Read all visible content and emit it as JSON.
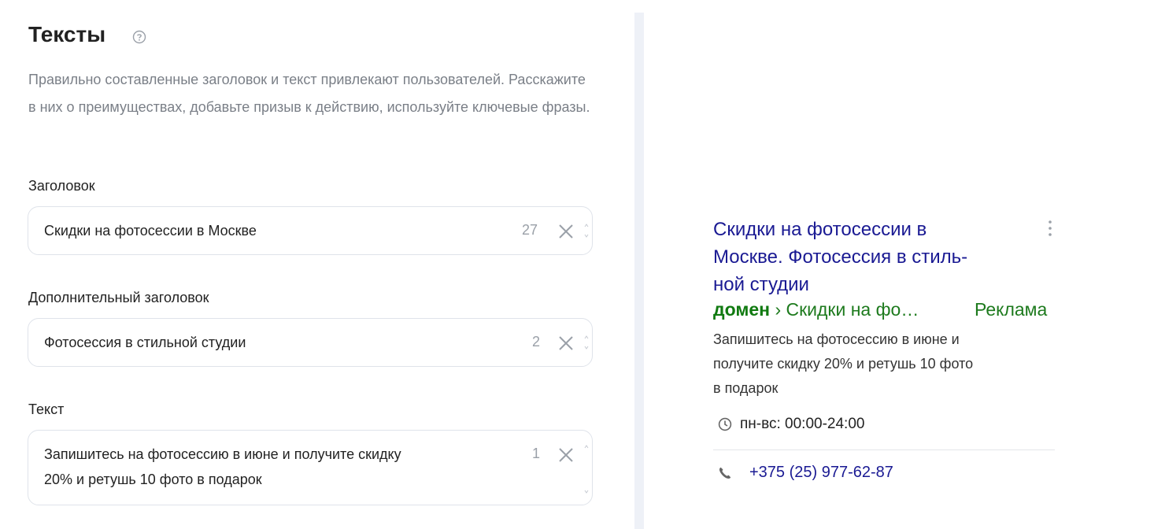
{
  "section": {
    "title": "Тексты",
    "description": "Правильно составленные заголовок и текст привлекают пользователей. Расскажите в них о преимуществах, добавьте призыв к действию, используйте ключевые фразы."
  },
  "fields": {
    "headline": {
      "label": "Заголовок",
      "value": "Скидки на фотосессии в Москве",
      "counter": "27"
    },
    "extra_headline": {
      "label": "Дополнительный заголовок",
      "value": "Фотосессия в стильной студии",
      "counter": "2"
    },
    "text": {
      "label": "Текст",
      "value_line1": "Запишитесь на фотосессию в июне и получите скидку",
      "value_line2": "20% и ретушь 10 фото в подарок",
      "counter": "1"
    }
  },
  "preview": {
    "title_line1": "Скидки на фотосессии в",
    "title_line2": "Москве. Фотосессия в стиль-",
    "title_line3": "ной студии",
    "domain": "домен",
    "path": "› Скидки на фо…",
    "ad_label": "Реклама",
    "text_line1": "Запишитесь на фотосессию в июне и",
    "text_line2": "получите скидку 20% и ретушь 10 фото",
    "text_line3": "в подарок",
    "hours": "пн-вс: 00:00-24:00",
    "phone": "+375 (25) 977-62-87"
  },
  "colors": {
    "link": "#1a1a93",
    "url_green": "#1d7a1d",
    "muted": "#7a7f87",
    "field_border": "#dfe3ea",
    "divider": "#eef1f7"
  },
  "icons": [
    "help-icon",
    "clear-icon",
    "resize-icon",
    "kebab-icon",
    "clock-icon",
    "phone-icon"
  ]
}
